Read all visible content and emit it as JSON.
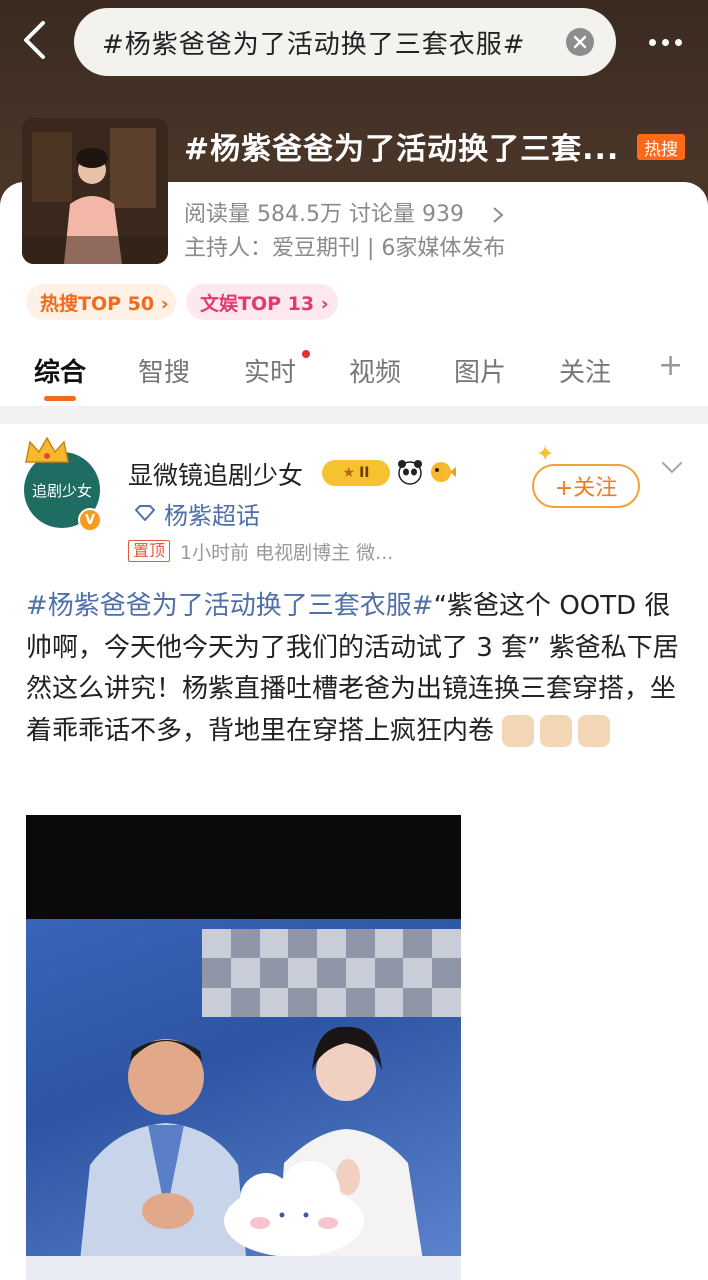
{
  "search": {
    "query": "#杨紫爸爸为了活动换了三套衣服#"
  },
  "topic": {
    "title": "#杨紫爸爸为了活动换了三套...",
    "hot_badge": "热搜",
    "stats": "阅读量 584.5万  讨论量 939",
    "host": "主持人：爱豆期刊 | 6家媒体发布",
    "ranks": [
      {
        "label": "热搜TOP 50 ›"
      },
      {
        "label": "文娱TOP 13 ›"
      }
    ]
  },
  "tabs": [
    {
      "label": "综合"
    },
    {
      "label": "智搜"
    },
    {
      "label": "实时"
    },
    {
      "label": "视频"
    },
    {
      "label": "图片"
    },
    {
      "label": "关注"
    },
    {
      "label": "+"
    }
  ],
  "post": {
    "avatar_text": "追剧少女",
    "author": "显微镜追剧少女",
    "level": "II",
    "supertopic": "杨紫超话",
    "pin_label": "置顶",
    "meta": "1小时前  电视剧博主 微...",
    "follow_label": "+关注",
    "hashtag": "#杨紫爸爸为了活动换了三套衣服#",
    "body": "“紫爸这个 OOTD 很帅啊，今天他今天为了我们的活动试了 3 套” 紫爸私下居然这么讲究！杨紫直播吐槽老爸为出镜连换三套穿搭，坐着乖乖话不多，背地里在穿搭上疯狂内卷"
  },
  "colors": {
    "accent": "#f26a1b",
    "link": "#4f70a8",
    "hot": "#ff6a1a"
  }
}
